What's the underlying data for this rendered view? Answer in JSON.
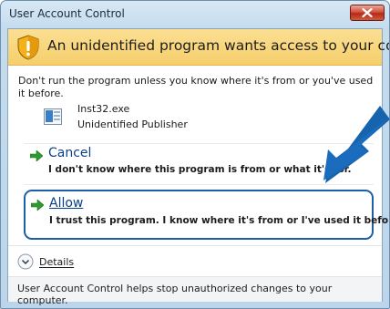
{
  "window": {
    "title": "User Account Control",
    "close_label": "X"
  },
  "banner": {
    "icon": "shield-warning-icon",
    "text": "An unidentified program wants access to your computer"
  },
  "warning_text": "Don't run the program unless you know where it's from or you've used it before.",
  "program": {
    "icon": "program-icon",
    "name": "Inst32.exe",
    "publisher": "Unidentified Publisher"
  },
  "options": {
    "cancel": {
      "icon": "green-arrow-icon",
      "title": "Cancel",
      "description": "I don't know where this program is from or what it's for."
    },
    "allow": {
      "icon": "green-arrow-icon",
      "title": "Allow",
      "description": "I trust this program. I know where it's from or I've used it before."
    }
  },
  "details": {
    "icon": "chevron-down-icon",
    "label": "Details"
  },
  "footer": {
    "text": "User Account Control helps stop unauthorized changes to your computer."
  },
  "colors": {
    "banner": "#f6cf6c",
    "highlight_border": "#1d5fa6",
    "pointer_arrow": "#1764ae",
    "link": "#0a3f8a"
  }
}
